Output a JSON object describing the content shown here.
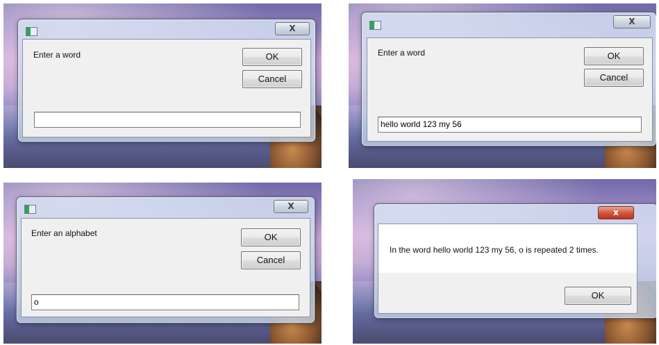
{
  "dialogs": [
    {
      "prompt": "Enter a word",
      "ok_label": "OK",
      "cancel_label": "Cancel",
      "input_value": ""
    },
    {
      "prompt": "Enter a word",
      "ok_label": "OK",
      "cancel_label": "Cancel",
      "input_value": "hello world 123 my 56"
    },
    {
      "prompt": "Enter an alphabet",
      "ok_label": "OK",
      "cancel_label": "Cancel",
      "input_value": "o"
    }
  ],
  "close_glyph": "X",
  "message_box": {
    "message": "In the word hello world 123 my 56, o is repeated 2 times.",
    "ok_label": "OK",
    "close_glyph": "x"
  }
}
